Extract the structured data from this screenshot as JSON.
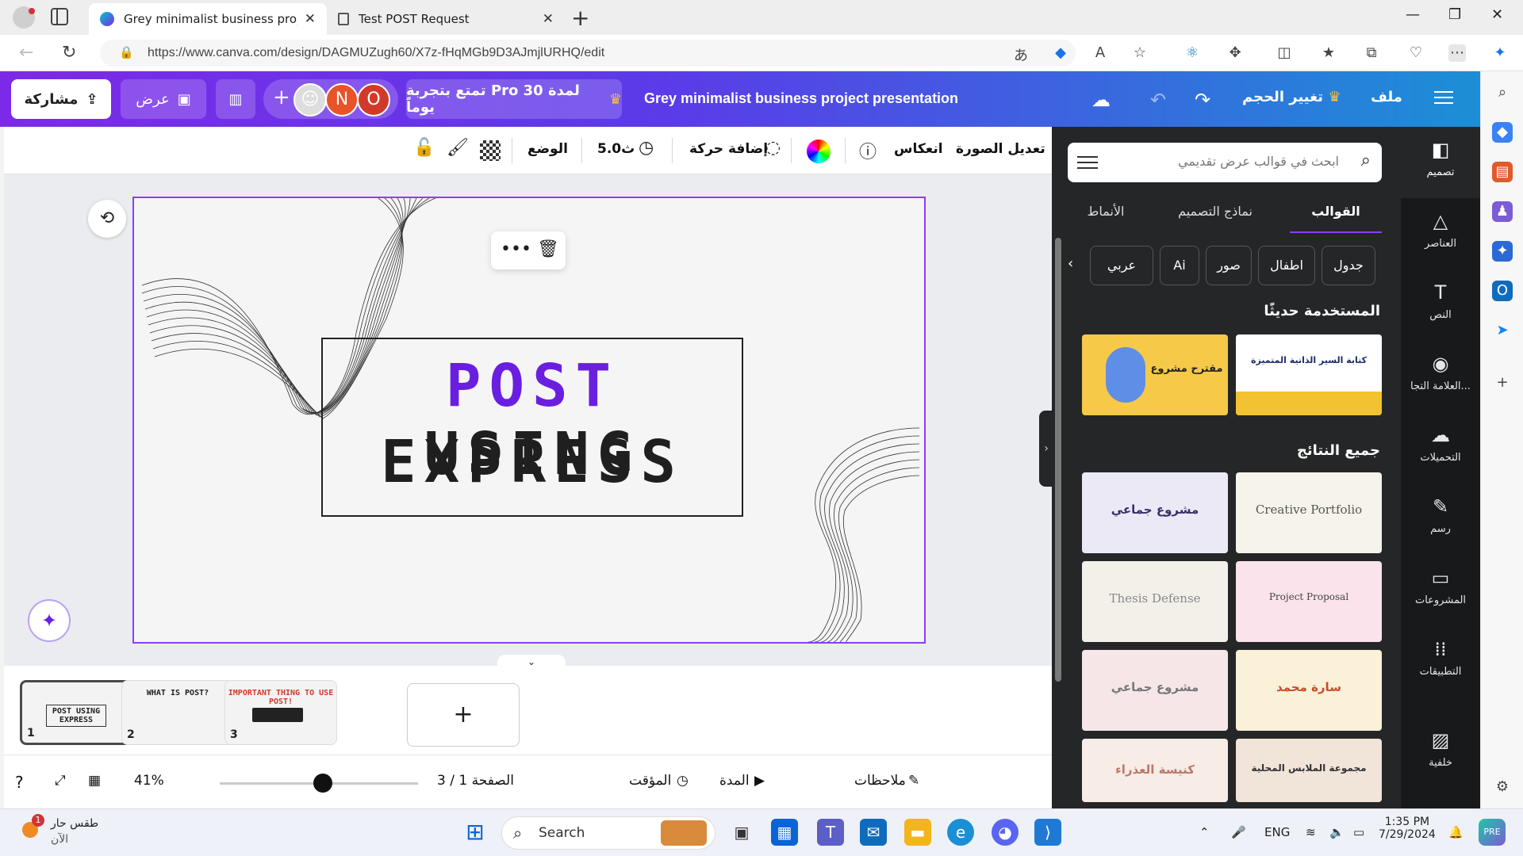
{
  "browser": {
    "tabs": [
      {
        "title": "Grey minimalist business project",
        "active": true
      },
      {
        "title": "Test POST Request",
        "active": false
      }
    ],
    "url": "https://www.canva.com/design/DAGMUZugh60/X7z-fHqMGb9D3AJmjlURHQ/edit"
  },
  "topbar": {
    "share_label": "مشاركة",
    "present_label": "عرض",
    "avatars": [
      "N",
      "O"
    ],
    "promo_label": "تمتع بتجربة Pro لمدة 30 يوماً",
    "doc_title": "Grey minimalist business project presentation",
    "resize_label": "تغيير الحجم",
    "file_label": "ملف"
  },
  "context_toolbar": {
    "edit_image": "تعديل الصورة",
    "flip": "انعكاس",
    "add_animation": "إضافة حركة",
    "duration": "5.0ث",
    "position": "الوضع"
  },
  "slide": {
    "title_word1": "POST",
    "title_word2": "USING",
    "title_line2": "EXPRESS"
  },
  "pages": {
    "thumbs": [
      {
        "num": "1",
        "title": "POST USING EXPRESS"
      },
      {
        "num": "2",
        "title": "WHAT IS POST?"
      },
      {
        "num": "3",
        "title": "IMPORTANT THING TO USE POST!"
      }
    ]
  },
  "bottombar": {
    "notes": "ملاحظات",
    "duration": "المدة",
    "timer": "المؤقت",
    "page_indicator": "الصفحة 1 / 3",
    "zoom": "41%",
    "zoom_level": 0.52
  },
  "panel": {
    "search_placeholder": "ابحث في قوالب عرض تقديمي",
    "tabs": [
      "القوالب",
      "نماذج التصميم",
      "الأنماط"
    ],
    "chips": [
      "جدول",
      "اطفال",
      "صور",
      "Ai",
      "عربي"
    ],
    "recent_heading": "المستخدمة حديثًا",
    "all_heading": "جميع النتائج",
    "recent": [
      {
        "text": "كتابة السير الذاتية المتميزة"
      },
      {
        "text": "مقترح مشروع"
      }
    ],
    "results": [
      {
        "text": "Creative Portfolio"
      },
      {
        "text": "مشروع جماعي"
      },
      {
        "text": "Project Proposal"
      },
      {
        "text": "Thesis Defense"
      },
      {
        "text": "سارة محمد"
      },
      {
        "text": "مشروع جماعي"
      },
      {
        "text": "مجموعة الملابس المحلية"
      },
      {
        "text": "كنيسة العذراء"
      }
    ]
  },
  "leftnav": {
    "items": [
      "تصميم",
      "العناصر",
      "النص",
      "العلامة التجا...",
      "التحميلات",
      "رسم",
      "المشروعات",
      "التطبيقات",
      "خلفية"
    ]
  },
  "taskbar": {
    "weather_title": "طقس حار",
    "weather_sub": "الآن",
    "weather_badge": "1",
    "search": "Search",
    "lang": "ENG",
    "time": "1:35 PM",
    "date": "7/29/2024"
  },
  "colors": {
    "accent": "#8b3dff",
    "title_purple": "#6a1fe0",
    "panel_bg": "#252627",
    "nav_bg": "#18191b"
  }
}
